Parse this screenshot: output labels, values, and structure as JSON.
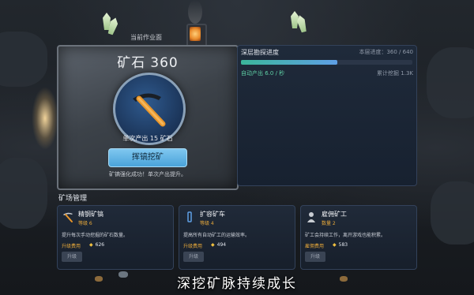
{
  "header": {
    "section_label": "当前作业面"
  },
  "ore_panel": {
    "title": "矿石",
    "value": "360",
    "yield_text": "单次产出 15 矿石",
    "mine_button": "挥镐挖矿",
    "message": "矿镐强化成功！单次产出提升。"
  },
  "progress_panel": {
    "title": "深层勘探进度",
    "progress_text": "本层进度：360 / 640",
    "progress": 0.5625,
    "rate_text": "自动产出 6.0 / 秒",
    "total_text": "累计挖掘 1.3K"
  },
  "management": {
    "title": "矿场管理",
    "cards": [
      {
        "name": "精钢矿镐",
        "level": "等级 6",
        "desc": "提升每次手动挖掘的矿石数量。",
        "cost_label": "升级费用",
        "cost": "626",
        "button": "升级",
        "icon": "pickaxe-icon"
      },
      {
        "name": "扩容矿车",
        "level": "等级 4",
        "desc": "提高所有自动矿工的运输效率。",
        "cost_label": "升级费用",
        "cost": "494",
        "button": "升级",
        "icon": "minecart-icon"
      },
      {
        "name": "雇佣矿工",
        "level": "数量 2",
        "desc": "矿工会持续工作，离开游戏也能积累。",
        "cost_label": "雇佣费用",
        "cost": "583",
        "button": "升级",
        "icon": "miner-icon"
      }
    ]
  },
  "caption": "深挖矿脉持续成长",
  "colors": {
    "accent": "#4aa3da",
    "gold": "#e8a93a",
    "green": "#5fd1a6"
  }
}
